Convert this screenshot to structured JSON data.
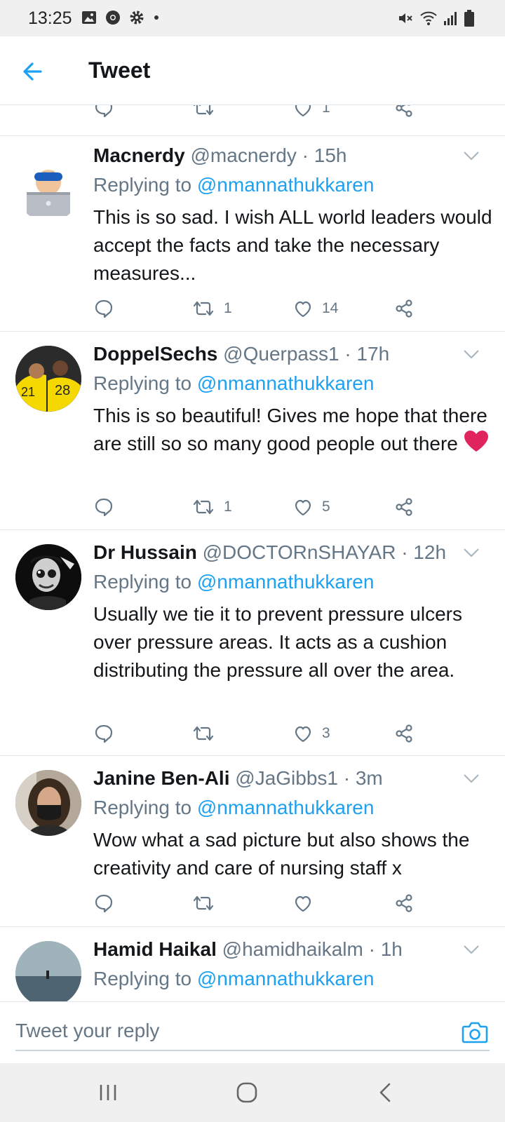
{
  "status_bar": {
    "time": "13:25"
  },
  "header": {
    "title": "Tweet"
  },
  "partial_tweet": {
    "likes": "1"
  },
  "tweets": [
    {
      "name": "Macnerdy",
      "meta": "@macnerdy · 15h",
      "replying_label": "Replying to",
      "mention": "@nmannathukkaren",
      "body": "This is so sad. I wish ALL world leaders would accept the facts and take the necessary measures...",
      "retweets": "1",
      "likes": "14"
    },
    {
      "name": "DoppelSechs",
      "meta": "@Querpass1 · 17h",
      "replying_label": "Replying to",
      "mention": "@nmannathukkaren",
      "body": "This is so beautiful! Gives me hope that there are still so so many good people out there",
      "retweets": "1",
      "likes": "5"
    },
    {
      "name": "Dr Hussain",
      "meta": "@DOCTORnSHAYAR · 12h",
      "replying_label": "Replying to",
      "mention": "@nmannathukkaren",
      "body": "Usually we tie it to prevent pressure ulcers over pressure areas. It acts as a cushion distributing the pressure all over the area.",
      "retweets": "",
      "likes": "3"
    },
    {
      "name": "Janine Ben-Ali",
      "meta": "@JaGibbs1 · 3m",
      "replying_label": "Replying to",
      "mention": "@nmannathukkaren",
      "body": "Wow what a sad picture but also shows the creativity and care of nursing staff x",
      "retweets": "",
      "likes": ""
    },
    {
      "name": "Hamid Haikal",
      "meta": "@hamidhaikalm · 1h",
      "replying_label": "Replying to",
      "mention": "@nmannathukkaren"
    }
  ],
  "reply_bar": {
    "placeholder": "Tweet your reply"
  },
  "colors": {
    "accent": "#1da1f2",
    "muted": "#657786",
    "heart": "#e0245e"
  }
}
